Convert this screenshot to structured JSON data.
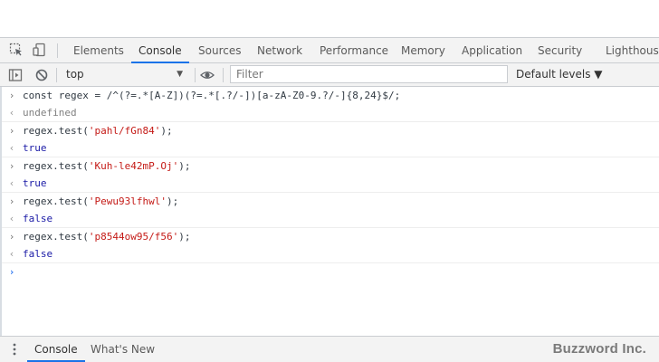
{
  "panel_tabs": [
    {
      "label": "Elements"
    },
    {
      "label": "Console"
    },
    {
      "label": "Sources"
    },
    {
      "label": "Network"
    },
    {
      "label": "Performance"
    },
    {
      "label": "Memory"
    },
    {
      "label": "Application"
    },
    {
      "label": "Security"
    },
    {
      "label": "Lighthouse"
    }
  ],
  "selected_tab": "Console",
  "toolbar": {
    "context": "top",
    "filter_placeholder": "Filter",
    "levels_label": "Default levels ▼"
  },
  "console": {
    "lines": [
      {
        "kind": "input",
        "prefix": ">",
        "code": "const regex = /^(?=.*[A-Z])(?=.*[.?/-])[a-zA-Z0-9.?/-]{8,24}$/;"
      },
      {
        "kind": "output",
        "prefix": "<·",
        "value": "undefined"
      },
      {
        "kind": "input",
        "prefix": ">",
        "call": "regex.test(",
        "arg": "'pahl/fGn84'",
        "end": ");"
      },
      {
        "kind": "output",
        "prefix": "<·",
        "value": "true"
      },
      {
        "kind": "input",
        "prefix": ">",
        "call": "regex.test(",
        "arg": "'Kuh-le42mP.Oj'",
        "end": ");"
      },
      {
        "kind": "output",
        "prefix": "<·",
        "value": "true"
      },
      {
        "kind": "input",
        "prefix": ">",
        "call": "regex.test(",
        "arg": "'Pewu93lfhwl'",
        "end": ");"
      },
      {
        "kind": "output",
        "prefix": "<·",
        "value": "false"
      },
      {
        "kind": "input",
        "prefix": ">",
        "call": "regex.test(",
        "arg": "'p8544ow95/f56'",
        "end": ");"
      },
      {
        "kind": "output",
        "prefix": "<·",
        "value": "false"
      }
    ],
    "prompt_prefix": ">"
  },
  "drawer": {
    "tabs": [
      {
        "label": "Console"
      },
      {
        "label": "What's New"
      }
    ],
    "watermark": "Buzzword Inc."
  },
  "colors": {
    "accent": "#1a73e8",
    "string": "#c41a16",
    "boolean": "#1a1aa6",
    "prompt": "#367cf1"
  },
  "icons": {
    "inspect": "inspect-element-icon",
    "device": "device-toggle-icon",
    "sidebar": "sidebar-toggle-icon",
    "clear": "clear-console-icon",
    "eye": "live-expression-eye-icon",
    "drawer_menu": "drawer-menu-icon"
  }
}
